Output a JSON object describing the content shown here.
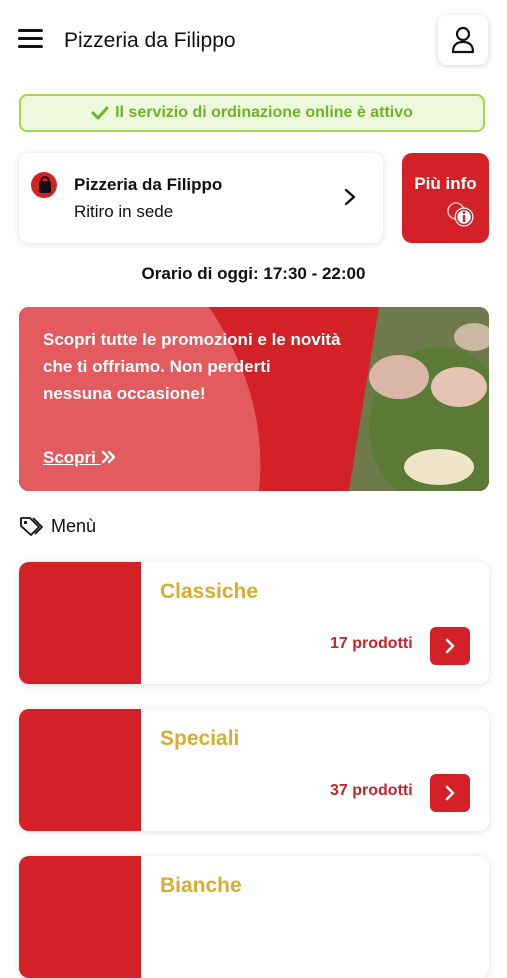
{
  "header": {
    "menu_icon": "hamburger-menu-icon",
    "title": "Pizzeria da Filippo",
    "user_icon": "user-icon"
  },
  "status": {
    "text": "Il servizio di ordinazione online è attivo",
    "icon": "check-icon",
    "color": "#6fb22b"
  },
  "store": {
    "name": "Pizzeria da Filippo",
    "mode": "Ritiro in sede",
    "icon": "shopping-bag-icon"
  },
  "info_button": {
    "label": "Più info",
    "icon": "info-icon"
  },
  "hours": "Orario di oggi: 17:30 - 22:00",
  "promo": {
    "text": "Scopri tutte le promozioni e le novità che ti offriamo. Non perderti nessuna occasione!",
    "link": "Scopri",
    "link_icon": "double-chevron-right-icon"
  },
  "menu": {
    "title": "Menù",
    "icon": "tags-icon"
  },
  "categories": [
    {
      "name": "Classiche",
      "count": "17 prodotti"
    },
    {
      "name": "Speciali",
      "count": "37 prodotti"
    },
    {
      "name": "Bianche",
      "count": ""
    }
  ],
  "colors": {
    "brand_red": "#d42027",
    "category_title": "#d8ad2c",
    "success_green": "#a6d64a"
  }
}
